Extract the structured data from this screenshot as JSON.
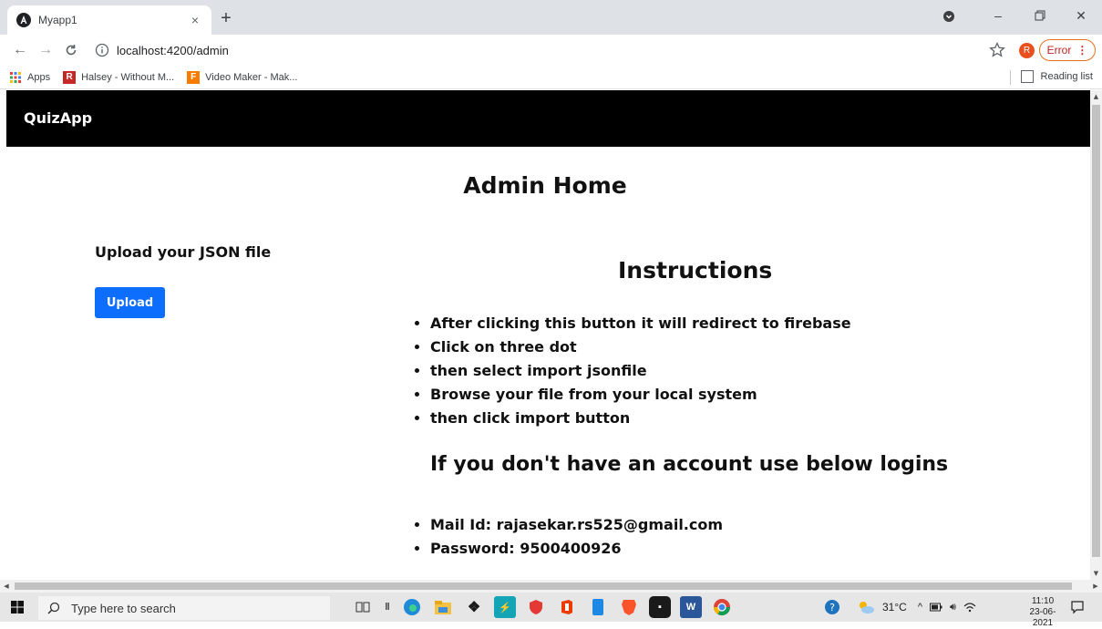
{
  "browser": {
    "tab_title": "Myapp1",
    "url": "localhost:4200/admin",
    "profile_initial": "R",
    "error_label": "Error",
    "bookmarks": [
      {
        "label": "Apps",
        "icon": "apps-grid-icon"
      },
      {
        "label": "Halsey - Without M...",
        "icon": "r-logo-icon",
        "color": "#c62828"
      },
      {
        "label": "Video Maker - Mak...",
        "icon": "f-logo-icon",
        "color": "#f57c00"
      }
    ],
    "reading_list": "Reading list"
  },
  "app": {
    "brand": "QuizApp",
    "page_title": "Admin Home",
    "upload_label": "Upload your JSON file",
    "upload_button": "Upload",
    "instructions_title": "Instructions",
    "instructions": [
      "After clicking this button it will redirect to firebase",
      "Click on three dot",
      "then select import jsonfile",
      "Browse your file from your local system",
      "then click import button"
    ],
    "login_title": "If you don't have an account use below logins",
    "logins": [
      "Mail Id: rajasekar.rs525@gmail.com",
      "Password: 9500400926"
    ],
    "accent_color": "#0d6efd"
  },
  "taskbar": {
    "search_placeholder": "Type here to search",
    "temperature": "31°C",
    "time": "11:10",
    "date": "23-06-2021"
  }
}
